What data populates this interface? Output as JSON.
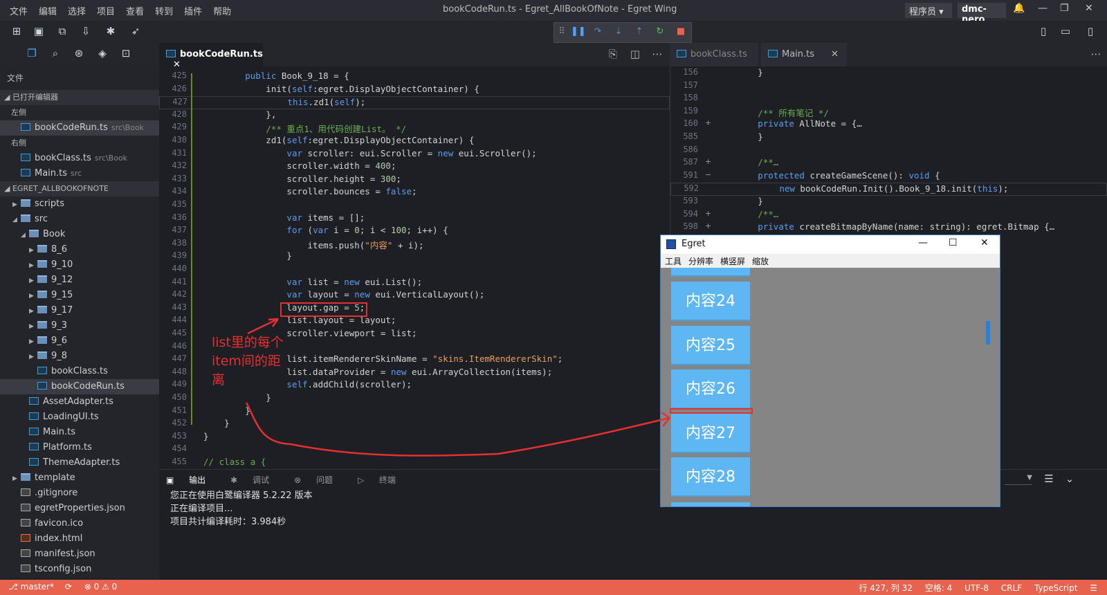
{
  "window": {
    "title": "bookCodeRun.ts - Egret_AllBookOfNote - Egret Wing",
    "menus": [
      "文件",
      "编辑",
      "选择",
      "项目",
      "查看",
      "转到",
      "插件",
      "帮助"
    ],
    "role": "程序员",
    "user": "dmc-nero"
  },
  "sidebar": {
    "header": "文件",
    "open_editors_label": "已打开编辑器",
    "left_label": "左侧",
    "right_label": "右侧",
    "open_left": [
      {
        "name": "bookCodeRun.ts",
        "hint": "src\\Book"
      }
    ],
    "open_right": [
      {
        "name": "bookClass.ts",
        "hint": "src\\Book"
      },
      {
        "name": "Main.ts",
        "hint": "src"
      }
    ],
    "project_label": "EGRET_ALLBOOKOFNOTE",
    "tree": [
      {
        "name": "scripts",
        "type": "folder",
        "level": 1,
        "arrow": "▶"
      },
      {
        "name": "src",
        "type": "folder",
        "level": 1,
        "arrow": "◢"
      },
      {
        "name": "Book",
        "type": "folder",
        "level": 2,
        "arrow": "◢"
      },
      {
        "name": "8_6",
        "type": "folder",
        "level": 3,
        "arrow": "▶"
      },
      {
        "name": "9_10",
        "type": "folder",
        "level": 3,
        "arrow": "▶"
      },
      {
        "name": "9_12",
        "type": "folder",
        "level": 3,
        "arrow": "▶"
      },
      {
        "name": "9_15",
        "type": "folder",
        "level": 3,
        "arrow": "▶"
      },
      {
        "name": "9_17",
        "type": "folder",
        "level": 3,
        "arrow": "▶"
      },
      {
        "name": "9_3",
        "type": "folder",
        "level": 3,
        "arrow": "▶"
      },
      {
        "name": "9_6",
        "type": "folder",
        "level": 3,
        "arrow": "▶"
      },
      {
        "name": "9_8",
        "type": "folder",
        "level": 3,
        "arrow": "▶"
      },
      {
        "name": "bookClass.ts",
        "type": "ts",
        "level": 3,
        "arrow": ""
      },
      {
        "name": "bookCodeRun.ts",
        "type": "ts",
        "level": 3,
        "arrow": "",
        "selected": true
      },
      {
        "name": "AssetAdapter.ts",
        "type": "ts",
        "level": 2,
        "arrow": ""
      },
      {
        "name": "LoadingUI.ts",
        "type": "ts",
        "level": 2,
        "arrow": ""
      },
      {
        "name": "Main.ts",
        "type": "ts",
        "level": 2,
        "arrow": ""
      },
      {
        "name": "Platform.ts",
        "type": "ts",
        "level": 2,
        "arrow": ""
      },
      {
        "name": "ThemeAdapter.ts",
        "type": "ts",
        "level": 2,
        "arrow": ""
      },
      {
        "name": "template",
        "type": "folder",
        "level": 1,
        "arrow": "▶"
      },
      {
        "name": ".gitignore",
        "type": "json",
        "level": 1,
        "arrow": ""
      },
      {
        "name": "egretProperties.json",
        "type": "json",
        "level": 1,
        "arrow": ""
      },
      {
        "name": "favicon.ico",
        "type": "json",
        "level": 1,
        "arrow": ""
      },
      {
        "name": "index.html",
        "type": "html",
        "level": 1,
        "arrow": ""
      },
      {
        "name": "manifest.json",
        "type": "json",
        "level": 1,
        "arrow": ""
      },
      {
        "name": "tsconfig.json",
        "type": "json",
        "level": 1,
        "arrow": ""
      }
    ]
  },
  "editor": {
    "active_tab": "bookCodeRun.ts",
    "other_tabs": [
      "bookClass.ts",
      "Main.ts"
    ],
    "lines": [
      {
        "n": "425",
        "t": "        public Book_9_18 = {"
      },
      {
        "n": "426",
        "t": "            init(self:egret.DisplayObjectContainer) {"
      },
      {
        "n": "427",
        "t": "                this.zd1(self);"
      },
      {
        "n": "428",
        "t": "            },"
      },
      {
        "n": "429",
        "t": "            /** 重点1、用代码创建List。 */"
      },
      {
        "n": "430",
        "t": "            zd1(self:egret.DisplayObjectContainer) {"
      },
      {
        "n": "431",
        "t": "                var scroller: eui.Scroller = new eui.Scroller();"
      },
      {
        "n": "432",
        "t": "                scroller.width = 400;"
      },
      {
        "n": "433",
        "t": "                scroller.height = 300;"
      },
      {
        "n": "434",
        "t": "                scroller.bounces = false;"
      },
      {
        "n": "435",
        "t": ""
      },
      {
        "n": "436",
        "t": "                var items = [];"
      },
      {
        "n": "437",
        "t": "                for (var i = 0; i < 100; i++) {"
      },
      {
        "n": "438",
        "t": "                    items.push(\"内容\" + i);"
      },
      {
        "n": "439",
        "t": "                }"
      },
      {
        "n": "440",
        "t": ""
      },
      {
        "n": "441",
        "t": "                var list = new eui.List();"
      },
      {
        "n": "442",
        "t": "                var layout = new eui.VerticalLayout();"
      },
      {
        "n": "443",
        "t": "                layout.gap = 5;"
      },
      {
        "n": "444",
        "t": "                list.layout = layout;"
      },
      {
        "n": "445",
        "t": "                scroller.viewport = list;"
      },
      {
        "n": "446",
        "t": ""
      },
      {
        "n": "447",
        "t": "                list.itemRendererSkinName = \"skins.ItemRendererSkin\";"
      },
      {
        "n": "448",
        "t": "                list.dataProvider = new eui.ArrayCollection(items);"
      },
      {
        "n": "449",
        "t": "                self.addChild(scroller);"
      },
      {
        "n": "450",
        "t": "            }"
      },
      {
        "n": "451",
        "t": "        }"
      },
      {
        "n": "452",
        "t": "    }"
      },
      {
        "n": "453",
        "t": "}"
      },
      {
        "n": "454",
        "t": ""
      },
      {
        "n": "455",
        "t": "// class a {"
      }
    ],
    "annotation": "list里的每个item间的距离"
  },
  "editor2": {
    "lines": [
      {
        "n": "156",
        "t": "        }",
        "fold": ""
      },
      {
        "n": "157",
        "t": "",
        "fold": ""
      },
      {
        "n": "158",
        "t": "",
        "fold": ""
      },
      {
        "n": "159",
        "t": "        /** 所有笔记 */",
        "fold": ""
      },
      {
        "n": "160",
        "t": "        private AllNote = {…",
        "fold": "+"
      },
      {
        "n": "585",
        "t": "        }",
        "fold": ""
      },
      {
        "n": "586",
        "t": "",
        "fold": ""
      },
      {
        "n": "587",
        "t": "        /**…",
        "fold": "+"
      },
      {
        "n": "591",
        "t": "        protected createGameScene(): void {",
        "fold": "−"
      },
      {
        "n": "592",
        "t": "            new bookCodeRun.Init().Book_9_18.init(this);",
        "fold": ""
      },
      {
        "n": "593",
        "t": "        }",
        "fold": ""
      },
      {
        "n": "594",
        "t": "        /**…",
        "fold": "+"
      },
      {
        "n": "598",
        "t": "        private createBitmapByName(name: string): egret.Bitmap {…",
        "fold": "+"
      }
    ]
  },
  "panel": {
    "tabs": [
      "输出",
      "调试",
      "问题",
      "终端"
    ],
    "output": [
      "您正在使用白鹭编译器 5.2.22 版本",
      "正在编译项目...",
      "项目共计编译耗时：3.984秒"
    ]
  },
  "egret_window": {
    "title": "Egret",
    "menu": [
      "工具",
      "分辨率",
      "横竖屏",
      "缩放"
    ],
    "items": [
      "内容24",
      "内容25",
      "内容26",
      "内容27",
      "内容28"
    ]
  },
  "status": {
    "branch": "master*",
    "errors": "0",
    "warnings": "0",
    "position": "行 427, 列 32",
    "spaces": "空格: 4",
    "encoding": "UTF-8",
    "eol": "CRLF",
    "language": "TypeScript"
  },
  "colors": {
    "status_bar": "#e8634e",
    "annotation": "#e53030",
    "list_item": "#5eb6f2"
  }
}
